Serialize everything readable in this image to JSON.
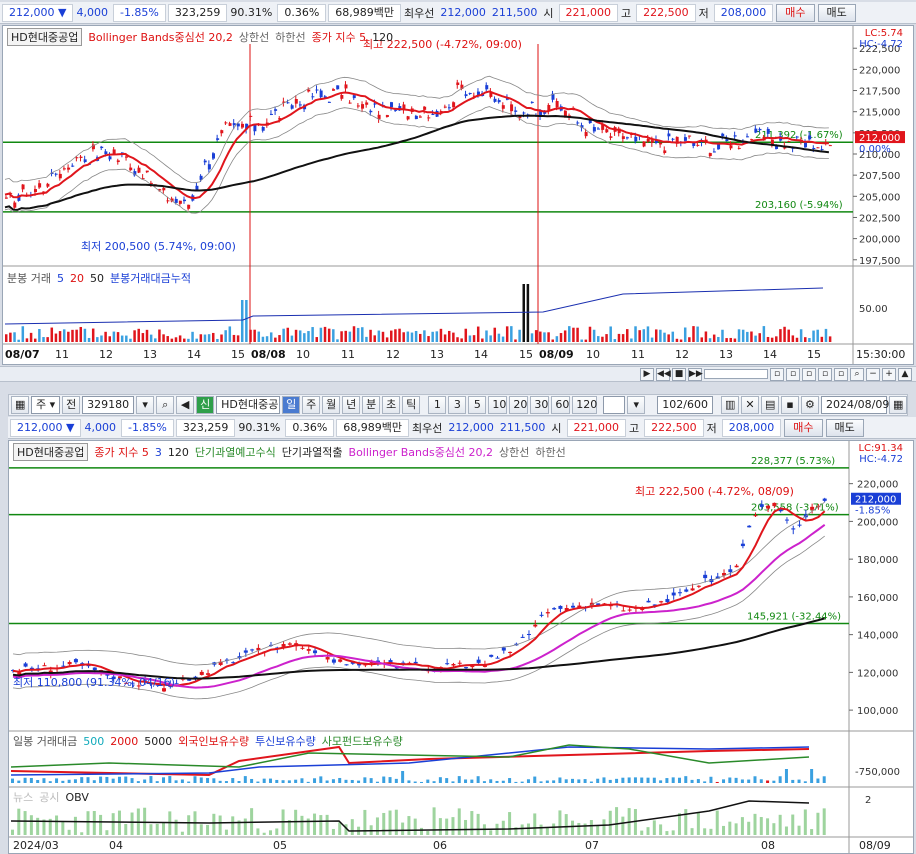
{
  "quote": {
    "price": "212,000",
    "arrow": "▼",
    "change": "4,000",
    "change_pct": "-1.85%",
    "volume": "323,259",
    "volume_ratio": "90.31%",
    "turnover_ratio": "0.36%",
    "amount": "68,989백만",
    "best_label": "최우선",
    "best_ask": "212,000",
    "best_bid": "211,500",
    "open_label": "시",
    "open": "221,000",
    "high_label": "고",
    "high": "222,500",
    "low_label": "저",
    "low": "208,000",
    "buy_label": "매수",
    "sell_label": "매도"
  },
  "top_chart": {
    "legend": {
      "name": "HD현대중공업",
      "bb": "Bollinger Bands중심선 20,2",
      "upper": "상한선",
      "lower": "하한선",
      "close_idx": "종가 지수 5",
      "close_n": "120"
    },
    "lc": "LC:5.74",
    "hc": "HC:-4.72",
    "y_ticks": [
      "222,500",
      "220,000",
      "217,500",
      "215,000",
      "212,500",
      "210,000",
      "207,500",
      "205,000",
      "202,500",
      "200,000",
      "197,500"
    ],
    "price_tag": "212,000",
    "price_tag_pct": "0.00%",
    "annotation_high": "최고 222,500 (-4.72%, 09:00)",
    "annotation_low": "최저 200,500 (5.74%, 09:00)",
    "line_upper": "211,392 (-1.67%)",
    "line_lower": "203,160 (-5.94%)",
    "sub_legend": {
      "a": "분봉 거래",
      "b": "5",
      "c": "20",
      "d": "50",
      "e": "분봉거래대금누적"
    },
    "sub_tick": "50.00",
    "x_ticks": [
      "08/07",
      "11",
      "12",
      "13",
      "14",
      "15",
      "08/08",
      "10",
      "11",
      "12",
      "13",
      "14",
      "15",
      "08/09",
      "10",
      "11",
      "12",
      "13",
      "14",
      "15"
    ],
    "time_label": "15:30:00"
  },
  "toolbar2": {
    "type": "주",
    "jeon": "전",
    "code": "329180",
    "badge": "신",
    "name": "HD현대중공",
    "periods": [
      "일",
      "주",
      "월",
      "년",
      "분",
      "초",
      "틱"
    ],
    "nums": [
      "1",
      "3",
      "5",
      "10",
      "20",
      "30",
      "60",
      "120"
    ],
    "count": "102",
    "total": "/600",
    "date": "2024/08/09"
  },
  "bottom_chart": {
    "legend": {
      "name": "HD현대중공업",
      "close_idx": "종가 지수 5",
      "n3": "3",
      "n120": "120",
      "short_warn": "단기과열예고수식",
      "short_hit": "단기과열적출",
      "bb": "Bollinger Bands중심선 20,2",
      "upper": "상한선",
      "lower": "하한선"
    },
    "lc": "LC:91.34",
    "hc": "HC:-4.72",
    "y_ticks": [
      "220,000",
      "200,000",
      "180,000",
      "160,000",
      "140,000",
      "120,000",
      "100,000"
    ],
    "price_tag": "212,000",
    "price_tag_pct": "-1.85%",
    "annotation_high": "최고 222,500 (-4.72%, 08/09)",
    "annotation_low": "최저 110,800 (91.34%, 04/16)",
    "line_upper": "228,377 (5.73%)",
    "line_mid": "203,558 (-3.71%)",
    "line_lower": "145,921 (-32.44%)",
    "sub1_legend": {
      "a": "일봉 거래대금",
      "b": "500",
      "c": "2000",
      "d": "5000",
      "e": "외국인보유수량",
      "f": "투신보유수량",
      "g": "사모펀드보유수량"
    },
    "sub1_tick": "-750,000",
    "sub2_legend": {
      "a": "뉴스",
      "b": "공시",
      "c": "OBV"
    },
    "sub2_tick": "2",
    "x_ticks": [
      "2024/03",
      "04",
      "05",
      "06",
      "07",
      "08"
    ],
    "end_label": "08/09"
  }
}
